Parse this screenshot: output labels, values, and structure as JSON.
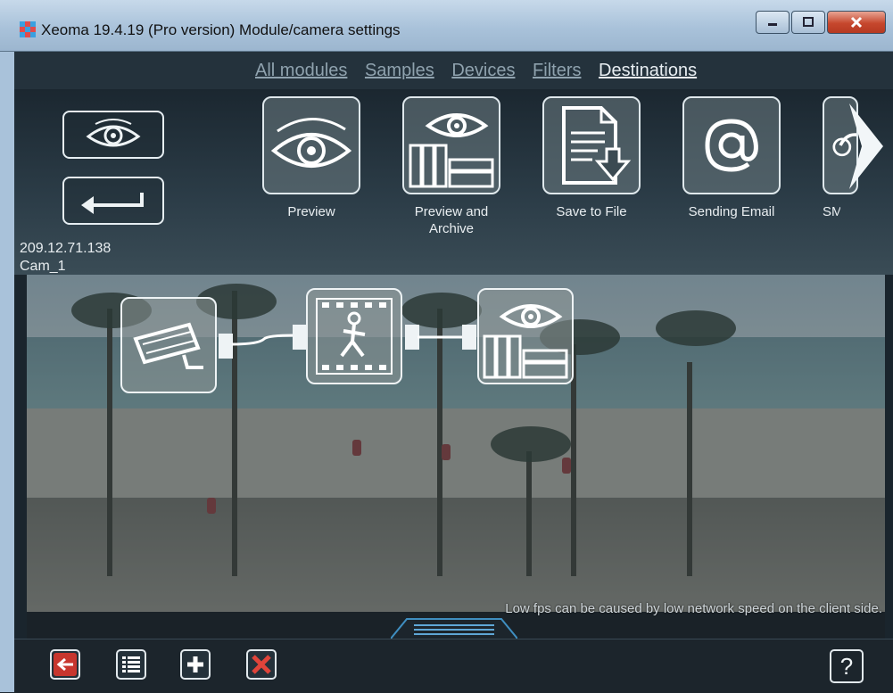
{
  "window": {
    "title": "Xeoma 19.4.19 (Pro version) Module/camera settings"
  },
  "tabs": [
    {
      "label": "All modules",
      "active": false
    },
    {
      "label": "Samples",
      "active": false
    },
    {
      "label": "Devices",
      "active": false
    },
    {
      "label": "Filters",
      "active": false
    },
    {
      "label": "Destinations",
      "active": true
    }
  ],
  "modules": [
    {
      "label": "Preview",
      "icon": "eye-icon"
    },
    {
      "label": "Preview and Archive",
      "icon": "eye-archive-icon"
    },
    {
      "label": "Save to File",
      "icon": "save-file-icon"
    },
    {
      "label": "Sending Email",
      "icon": "at-icon"
    },
    {
      "label": "SM",
      "icon": "eye-icon"
    }
  ],
  "camera_info": {
    "ip": "209.12.71.138",
    "name": "Cam_1"
  },
  "chain": [
    "camera-module-icon",
    "motion-detector-icon",
    "preview-archive-icon"
  ],
  "notice": "Low fps can be caused by low network speed on the client side.",
  "help_label": "?",
  "colors": {
    "accent_red": "#e0443a",
    "panel": "#1c252c"
  }
}
